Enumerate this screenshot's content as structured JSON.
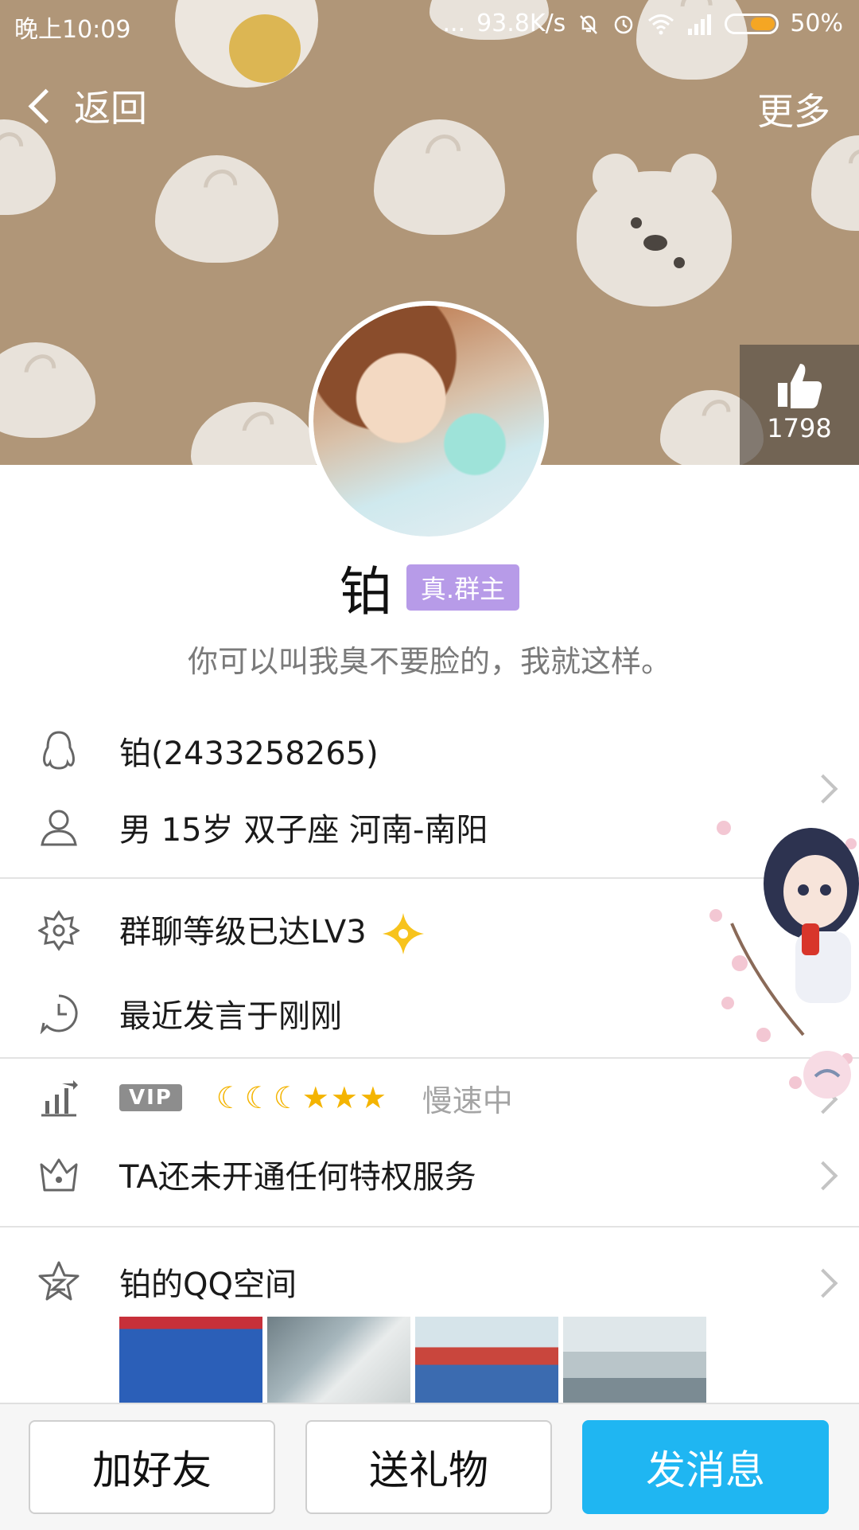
{
  "status_bar": {
    "time": "晚上10:09",
    "dots": "...",
    "net_speed": "93.8K/s",
    "battery": "50%"
  },
  "nav": {
    "back_label": "返回",
    "more_label": "更多"
  },
  "like": {
    "count": "1798"
  },
  "profile": {
    "name": "铂",
    "badge": "真.群主",
    "signature": "你可以叫我臭不要脸的，我就这样。"
  },
  "info": {
    "qq_line": "铂(2433258265)",
    "personal_line": "男  15岁  双子座  河南-南阳",
    "group_level": "群聊等级已达LV3",
    "last_speak": "最近发言于刚刚",
    "vip_tag": "VIP",
    "grade_icons": "☾☾☾★★★",
    "speed": "慢速中",
    "privilege": "TA还未开通任何特权服务",
    "qzone": "铂的QQ空间"
  },
  "actions": {
    "add_friend": "加好友",
    "send_gift": "送礼物",
    "send_message": "发消息"
  },
  "colors": {
    "accent_blue": "#1fb6f2",
    "badge_purple": "#b79be8",
    "banner": "#b09678"
  }
}
